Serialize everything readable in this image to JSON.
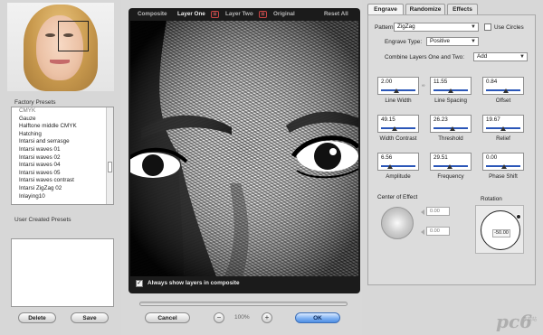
{
  "left_panel": {
    "factory_label": "Factory Presets",
    "presets": [
      "CMYK",
      "Gauze",
      "Halftone middle CMYK",
      "Hatching",
      "Intarsi and serrasge",
      "Intarsi waves 01",
      "Intarsi waves 02",
      "Intarsi waves 04",
      "Intarsi waves 05",
      "Intarsi waves contrast",
      "Intarsi ZigZag 02",
      "Inlaying10"
    ],
    "user_label": "User Created Presets",
    "delete_label": "Delete",
    "save_label": "Save"
  },
  "canvas": {
    "tabs": [
      "Composite",
      "Layer One",
      "Layer Two",
      "Original",
      "Reset All"
    ],
    "active_tab": "Layer One",
    "badge": "⊠",
    "always_show_label": "Always show layers in composite",
    "always_show_checked": true,
    "zoom_value": "100%",
    "cancel_label": "Cancel",
    "ok_label": "OK",
    "zoom_out": "−",
    "zoom_in": "+"
  },
  "right_panel": {
    "tabs": [
      "Engrave",
      "Randomize",
      "Effects"
    ],
    "active_tab": "Engrave",
    "pattern_label": "Pattern:",
    "pattern_value": "ZigZag",
    "use_circles_label": "Use Circles",
    "engrave_type_label": "Engrave Type:",
    "engrave_type_value": "Positive",
    "combine_label": "Combine Layers One and Two:",
    "combine_value": "Add",
    "sliders": [
      {
        "label": "Line Width",
        "value": "2.00",
        "level": 0.42
      },
      {
        "label": "Line Spacing",
        "value": "11.55",
        "level": 0.48
      },
      {
        "label": "Offset",
        "value": "0.84",
        "level": 0.55
      },
      {
        "label": "Width Contrast",
        "value": "49.15",
        "level": 0.35
      },
      {
        "label": "Threshold",
        "value": "26.23",
        "level": 0.52
      },
      {
        "label": "Relief",
        "value": "19.67",
        "level": 0.46
      },
      {
        "label": "Amplitude",
        "value": "6.56",
        "level": 0.22
      },
      {
        "label": "Frequency",
        "value": "29.51",
        "level": 0.44
      },
      {
        "label": "Phase Shift",
        "value": "0.00",
        "level": 0.5
      }
    ],
    "center_label": "Center of Effect",
    "center_x": "0.00",
    "center_y": "0.00",
    "rotation_label": "Rotation",
    "rotation_value": "-50.00"
  },
  "watermark": {
    "text": "pc6",
    "sub": "下载站"
  },
  "colors": {
    "ok_blue": "#4e8fe3",
    "slider_track": "#2a56b8"
  }
}
